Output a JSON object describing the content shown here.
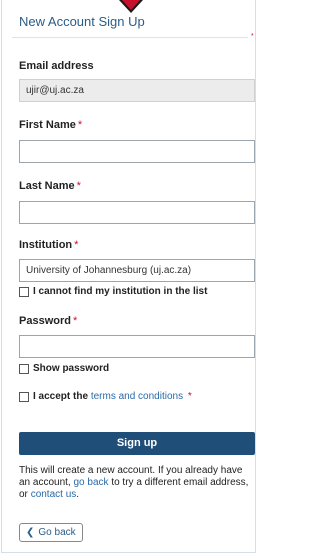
{
  "form": {
    "title": "New Account Sign Up",
    "email_label": "Email address",
    "email_value": "ujir@uj.ac.za",
    "first_name_label": "First Name",
    "last_name_label": "Last Name",
    "institution_label": "Institution",
    "institution_value": "University of Johannesburg (uj.ac.za)",
    "institution_missing_label": "I cannot find my institution in the list",
    "password_label": "Password",
    "show_password_label": "Show password",
    "accept_prefix": "I accept the",
    "terms_link": "terms and conditions",
    "required_marker": "*",
    "signup_button": "Sign up",
    "info_part1": "This will create a new account. If you already have an account,",
    "go_back_link": "go back",
    "info_part2": "to try a different email address, or",
    "contact_link": "contact us",
    "info_end": ".",
    "go_back_button": "Go back"
  },
  "colors": {
    "accent": "#1f4e79",
    "link": "#2a6aa8",
    "required": "#c8102e"
  },
  "icons": {
    "pointer": "red-down-arrow-marker",
    "back": "chevron-left-icon"
  }
}
